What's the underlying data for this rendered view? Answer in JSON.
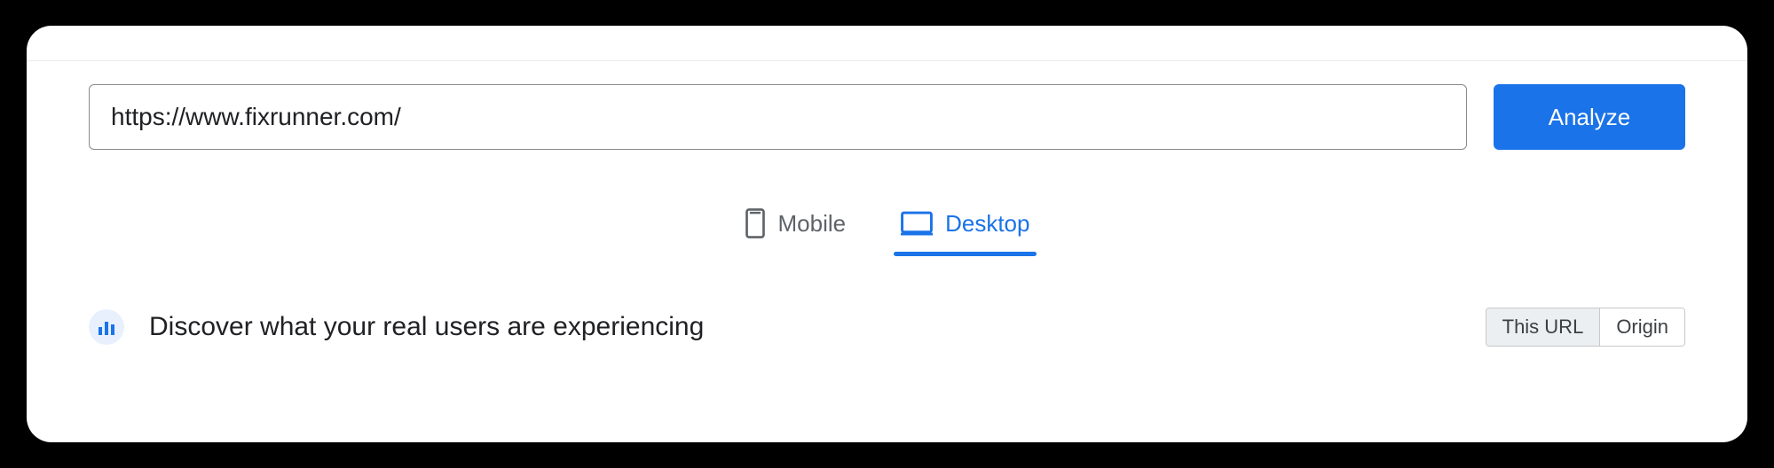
{
  "search": {
    "url_value": "https://www.fixrunner.com/",
    "analyze_label": "Analyze"
  },
  "tabs": {
    "mobile_label": "Mobile",
    "desktop_label": "Desktop",
    "active": "desktop"
  },
  "discover": {
    "heading": "Discover what your real users are experiencing"
  },
  "scope": {
    "this_url_label": "This URL",
    "origin_label": "Origin",
    "active": "this_url"
  }
}
